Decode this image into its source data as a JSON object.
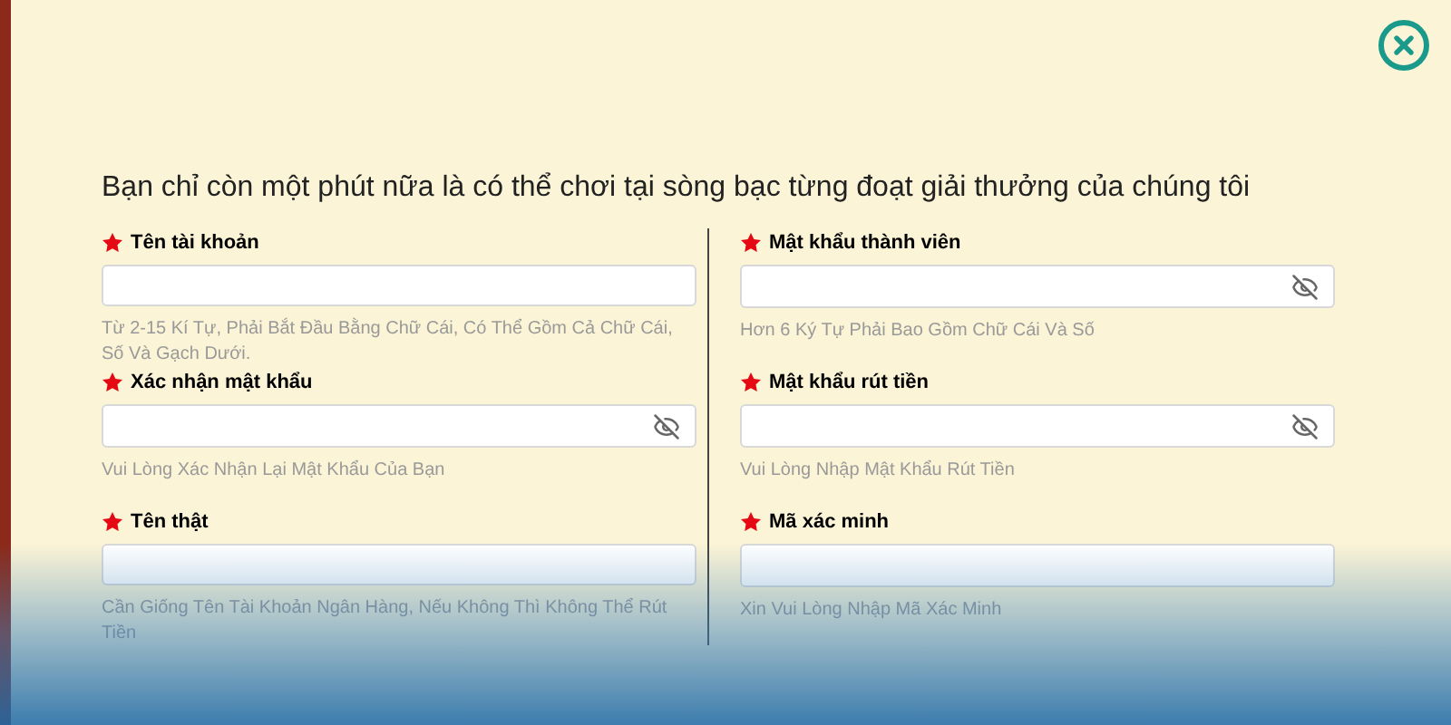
{
  "heading": "Bạn chỉ còn một phút nữa là có thể chơi tại sòng bạc từng đoạt giải thưởng của chúng tôi",
  "columns": [
    {
      "fields": [
        {
          "label": "Tên tài khoản",
          "required": true,
          "kind": "text",
          "hint": "Từ 2-15 Kí Tự, Phải Bắt Đầu Bằng Chữ Cái, Có Thể Gồm Cả Chữ Cái, Số Và Gạch Dưới."
        },
        {
          "label": "Xác nhận mật khẩu",
          "required": true,
          "kind": "password",
          "hint": "Vui Lòng Xác Nhận Lại Mật Khẩu Của Bạn"
        },
        {
          "label": "Tên thật",
          "required": true,
          "kind": "text",
          "hint": "Cần Giống Tên Tài Khoản Ngân Hàng, Nếu Không Thì Không Thể Rút Tiền"
        }
      ]
    },
    {
      "fields": [
        {
          "label": "Mật khẩu thành viên",
          "required": true,
          "kind": "password",
          "hint": "Hơn 6 Ký Tự Phải Bao Gồm Chữ Cái Và Số"
        },
        {
          "label": "Mật khẩu rút tiền",
          "required": true,
          "kind": "password",
          "hint": "Vui Lòng Nhập Mật Khẩu Rút Tiền"
        },
        {
          "label": "Mã xác minh",
          "required": true,
          "kind": "text",
          "hint": "Xin Vui Lòng Nhập Mã Xác Minh"
        }
      ]
    }
  ]
}
